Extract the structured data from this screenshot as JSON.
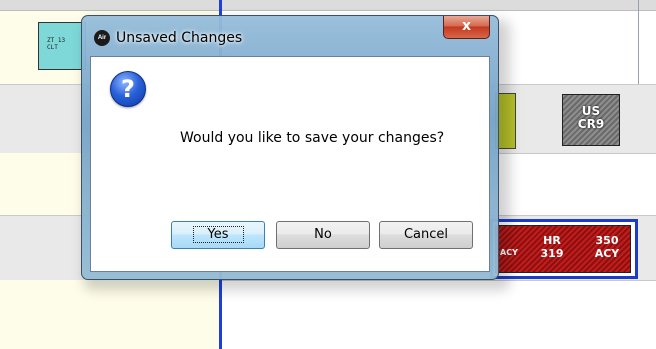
{
  "background": {
    "blocks": {
      "cyan_text_line1": "ZT 13",
      "cyan_text_line2": "CLT",
      "gray_line1": "US",
      "gray_line2": "CR9",
      "red_left": "ACY",
      "red_mid_line1": "HR",
      "red_mid_line2": "319",
      "red_right_line1": "350",
      "red_right_line2": "ACY"
    }
  },
  "dialog": {
    "app_icon_label": "Air",
    "title": "Unsaved Changes",
    "close_label": "x",
    "icon": "question-icon",
    "message": "Would you like to save your changes?",
    "buttons": {
      "yes": "Yes",
      "no": "No",
      "cancel": "Cancel"
    }
  },
  "colors": {
    "dialog_frame": "#7ea6c8",
    "close_button": "#c4391f",
    "timeline_line": "#1f3fd8",
    "block_red": "#c21d1d"
  }
}
